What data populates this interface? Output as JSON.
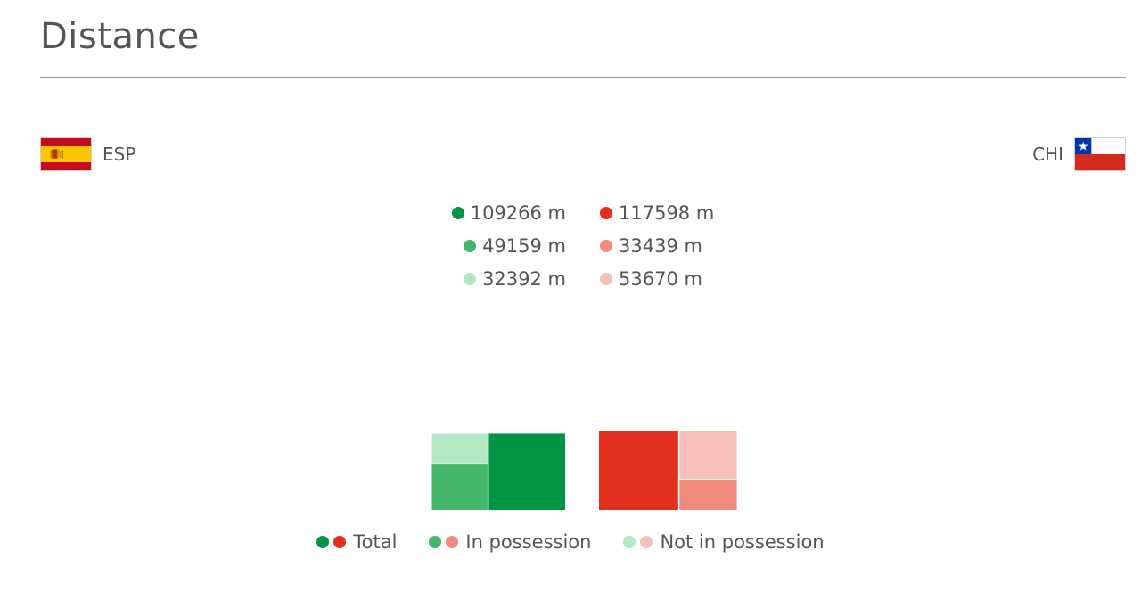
{
  "header": {
    "title": "Distance"
  },
  "teams": {
    "home": {
      "code": "ESP",
      "flag_icon": "spain-flag-icon",
      "color_total": "#009447",
      "color_in_possession": "#43b76a",
      "color_not_in_possession": "#b2e8c2"
    },
    "away": {
      "code": "CHI",
      "flag_icon": "chile-flag-icon",
      "color_total": "#e3301e",
      "color_in_possession": "#f08a7d",
      "color_not_in_possession": "#f7c1ba"
    }
  },
  "stats": {
    "home": {
      "total": "109266 m",
      "in_possession": "49159 m",
      "not_in_possession": "32392 m"
    },
    "away": {
      "total": "117598 m",
      "in_possession": "33439 m",
      "not_in_possession": "53670 m"
    }
  },
  "legend": {
    "total": "Total",
    "in_possession": "In possession",
    "not_in_possession": "Not in possession"
  },
  "chart_data": {
    "type": "treemap",
    "unit": "m",
    "series": [
      {
        "team": "ESP",
        "total": 109266,
        "in_possession": 49159,
        "not_in_possession": 32392
      },
      {
        "team": "CHI",
        "total": 117598,
        "in_possession": 33439,
        "not_in_possession": 53670
      }
    ]
  }
}
